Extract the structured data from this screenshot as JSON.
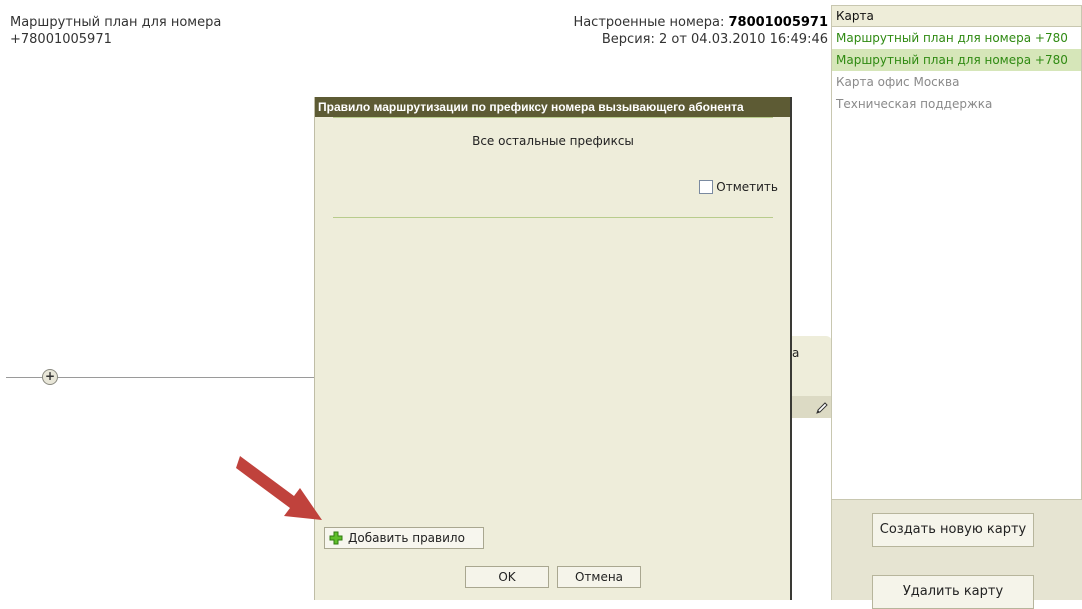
{
  "plan": {
    "title_line1": "Маршрутный план для номера",
    "title_line2": "+78001005971"
  },
  "header": {
    "numbers_label": "Настроенные номера:",
    "numbers_value": "78001005971",
    "version": "Версия: 2 от 04.03.2010 16:49:46"
  },
  "node": {
    "tail_text": "а"
  },
  "map_panel": {
    "header": "Карта",
    "items": [
      {
        "label": "Маршрутный план для номера +780",
        "state": "green"
      },
      {
        "label": "Маршрутный план для номера +780",
        "state": "selected"
      },
      {
        "label": "Карта офис Москва",
        "state": "normal"
      },
      {
        "label": "Техническая поддержка",
        "state": "normal"
      }
    ],
    "create_button": "Создать новую карту",
    "delete_button": "Удалить карту"
  },
  "dialog": {
    "title": "Правило маршрутизации по префиксу номера вызывающего абонента",
    "subtitle": "Все остальные префиксы",
    "mark_label": "Отметить",
    "add_rule_label": "Добавить правило",
    "ok_label": "OK",
    "cancel_label": "Отмена"
  },
  "colors": {
    "accent_green": "#2f8a12",
    "title_bar": "#5d5b34",
    "arrow": "#c0423c",
    "selected_bg": "#d6e6b9"
  },
  "icons": {
    "add_rule": "plus-icon",
    "edit": "pencil-icon",
    "canvas_add": "plus-circle-icon",
    "annotation": "arrow-icon"
  }
}
